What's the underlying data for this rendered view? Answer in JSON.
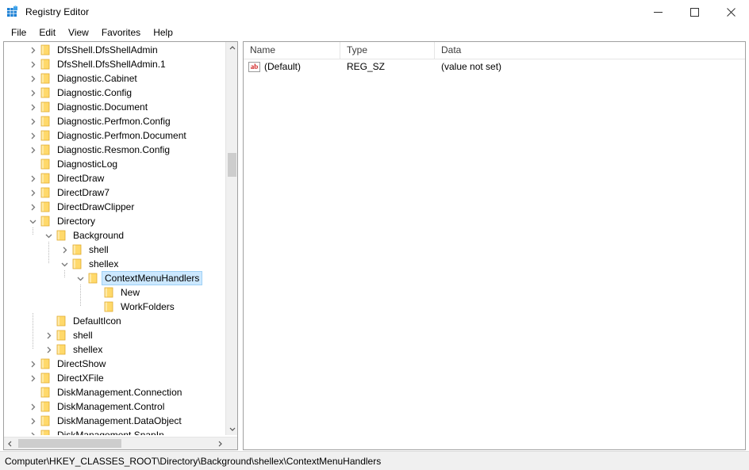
{
  "window": {
    "title": "Registry Editor",
    "app_icon": "registry-icon",
    "controls": {
      "minimize": "minimize-icon",
      "maximize": "maximize-icon",
      "close": "close-icon"
    }
  },
  "menubar": {
    "items": [
      "File",
      "Edit",
      "View",
      "Favorites",
      "Help"
    ]
  },
  "tree": {
    "rows": [
      {
        "label": "DfsShell.DfsShellAdmin",
        "depth": 1,
        "expander": "collapsed",
        "selected": false
      },
      {
        "label": "DfsShell.DfsShellAdmin.1",
        "depth": 1,
        "expander": "collapsed",
        "selected": false
      },
      {
        "label": "Diagnostic.Cabinet",
        "depth": 1,
        "expander": "collapsed",
        "selected": false
      },
      {
        "label": "Diagnostic.Config",
        "depth": 1,
        "expander": "collapsed",
        "selected": false
      },
      {
        "label": "Diagnostic.Document",
        "depth": 1,
        "expander": "collapsed",
        "selected": false
      },
      {
        "label": "Diagnostic.Perfmon.Config",
        "depth": 1,
        "expander": "collapsed",
        "selected": false
      },
      {
        "label": "Diagnostic.Perfmon.Document",
        "depth": 1,
        "expander": "collapsed",
        "selected": false
      },
      {
        "label": "Diagnostic.Resmon.Config",
        "depth": 1,
        "expander": "collapsed",
        "selected": false
      },
      {
        "label": "DiagnosticLog",
        "depth": 1,
        "expander": "none",
        "selected": false
      },
      {
        "label": "DirectDraw",
        "depth": 1,
        "expander": "collapsed",
        "selected": false
      },
      {
        "label": "DirectDraw7",
        "depth": 1,
        "expander": "collapsed",
        "selected": false
      },
      {
        "label": "DirectDrawClipper",
        "depth": 1,
        "expander": "collapsed",
        "selected": false
      },
      {
        "label": "Directory",
        "depth": 1,
        "expander": "expanded",
        "selected": false
      },
      {
        "label": "Background",
        "depth": 2,
        "expander": "expanded",
        "selected": false
      },
      {
        "label": "shell",
        "depth": 3,
        "expander": "collapsed",
        "selected": false
      },
      {
        "label": "shellex",
        "depth": 3,
        "expander": "expanded",
        "selected": false
      },
      {
        "label": "ContextMenuHandlers",
        "depth": 4,
        "expander": "expanded",
        "selected": true
      },
      {
        "label": "New",
        "depth": 5,
        "expander": "none",
        "selected": false
      },
      {
        "label": "WorkFolders",
        "depth": 5,
        "expander": "none",
        "selected": false
      },
      {
        "label": "DefaultIcon",
        "depth": 2,
        "expander": "none",
        "selected": false
      },
      {
        "label": "shell",
        "depth": 2,
        "expander": "collapsed",
        "selected": false
      },
      {
        "label": "shellex",
        "depth": 2,
        "expander": "collapsed",
        "selected": false
      },
      {
        "label": "DirectShow",
        "depth": 1,
        "expander": "collapsed",
        "selected": false
      },
      {
        "label": "DirectXFile",
        "depth": 1,
        "expander": "collapsed",
        "selected": false
      },
      {
        "label": "DiskManagement.Connection",
        "depth": 1,
        "expander": "none",
        "selected": false
      },
      {
        "label": "DiskManagement.Control",
        "depth": 1,
        "expander": "collapsed",
        "selected": false
      },
      {
        "label": "DiskManagement.DataObject",
        "depth": 1,
        "expander": "collapsed",
        "selected": false
      },
      {
        "label": "DiskManagement.SnapIn",
        "depth": 1,
        "expander": "collapsed",
        "selected": false
      }
    ],
    "scroll": {
      "vertical_up": "scroll-up-arrow",
      "vertical_down": "scroll-down-arrow",
      "horizontal_left": "scroll-left-arrow",
      "horizontal_right": "scroll-right-arrow"
    }
  },
  "list": {
    "columns": [
      "Name",
      "Type",
      "Data"
    ],
    "rows": [
      {
        "icon": "string-value-icon",
        "name": "(Default)",
        "type": "REG_SZ",
        "data": "(value not set)"
      }
    ]
  },
  "statusbar": {
    "path": "Computer\\HKEY_CLASSES_ROOT\\Directory\\Background\\shellex\\ContextMenuHandlers"
  },
  "colors": {
    "selection": "#cce8ff",
    "folder": "#ffd54a",
    "accent": "#0078d7"
  }
}
